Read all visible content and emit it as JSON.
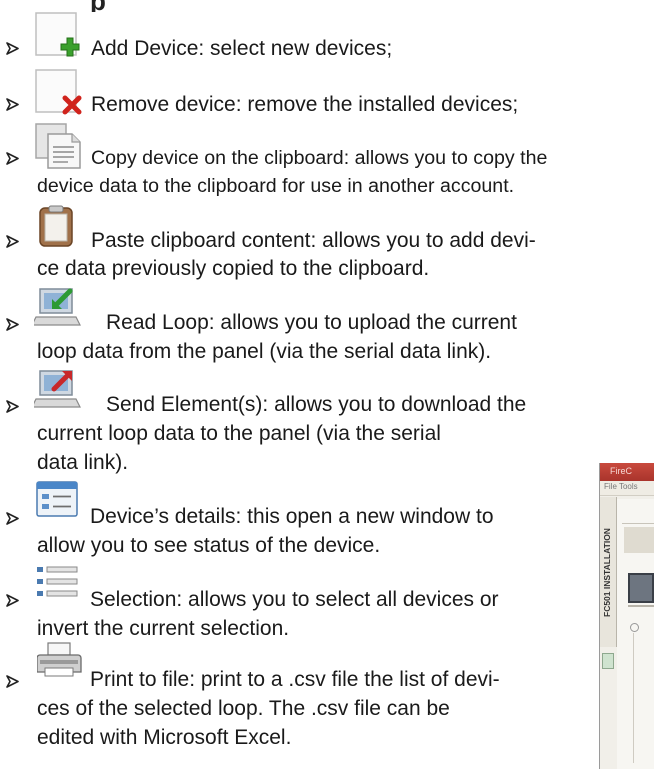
{
  "heading_fragment": "p",
  "items": [
    {
      "icon": "add-device-icon",
      "text": "Add Device: select new devices;"
    },
    {
      "icon": "remove-device-icon",
      "text": "Remove device: remove the installed devices;"
    },
    {
      "icon": "copy-icon",
      "line1": "Copy device on the clipboard: allows you to copy the",
      "line2": "device data to the clipboard for use in another account."
    },
    {
      "icon": "clipboard-paste-icon",
      "line1": "Paste clipboard content: allows you to add devi-",
      "line2": "ce data previously copied to the clipboard."
    },
    {
      "icon": "read-loop-icon",
      "line1": "Read Loop: allows you to upload the current",
      "line2": "loop data from the panel (via the serial data link)."
    },
    {
      "icon": "send-element-icon",
      "line1": "Send Element(s): allows you to download the",
      "line2": "current loop data to the panel (via the serial",
      "line3": "data link)."
    },
    {
      "icon": "device-details-icon",
      "line1": "Device’s details: this open a new window to",
      "line2": "allow you to see status of the device."
    },
    {
      "icon": "selection-icon",
      "line1": "Selection: allows you to select all devices or",
      "line2": "invert the current selection."
    },
    {
      "icon": "printer-icon",
      "line1": "Print to file: print to a .csv file the list of devi-",
      "line2": "ces of the selected loop. The .csv file can be",
      "line3": "edited with Microsoft Excel."
    }
  ],
  "side_window": {
    "title": "FireC",
    "menu": "File  Tools",
    "tab_label": "FC501 INSTALLATION"
  },
  "colors": {
    "text": "#1a1a1a",
    "add_green": "#3aa02c",
    "remove_red": "#d0231c",
    "window_title": "#b83d33"
  }
}
